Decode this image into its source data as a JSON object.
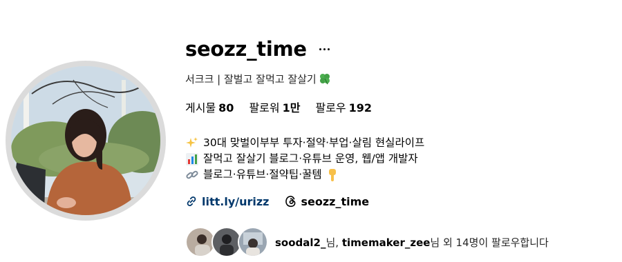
{
  "profile": {
    "username": "seozz_time",
    "more_label": "…",
    "category_text": "서크크 | 잘벌고 잘먹고 잘살기",
    "category_emoji": "four-leaf-clover-icon"
  },
  "stats": {
    "posts_label": "게시물",
    "posts_value": "80",
    "followers_label": "팔로워",
    "followers_value": "1만",
    "following_label": "팔로우",
    "following_value": "192"
  },
  "bio": {
    "lines": [
      {
        "icon": "sparkles-icon",
        "text": "30대 맞벌이부부 투자·절약·부업·살림 현실라이프"
      },
      {
        "icon": "bar-chart-icon",
        "text": "잘먹고 잘살기 블로그·유튜브 운영, 웹/앱 개발자"
      },
      {
        "icon": "link-icon",
        "text": "블로그·유튜브·절약팁·꿀템"
      }
    ],
    "line3_trailing_icon": "pointing-down-icon"
  },
  "links": {
    "website": "litt.ly/urizz",
    "threads_handle": "seozz_time"
  },
  "followed_by": {
    "user1": "soodal2_",
    "sep1": "님, ",
    "user2": "timemaker_zee",
    "suffix": "님 외 14명이 팔로우합니다"
  },
  "colors": {
    "link": "#00376b",
    "ring": "#dbdbdb",
    "text": "#000000"
  }
}
